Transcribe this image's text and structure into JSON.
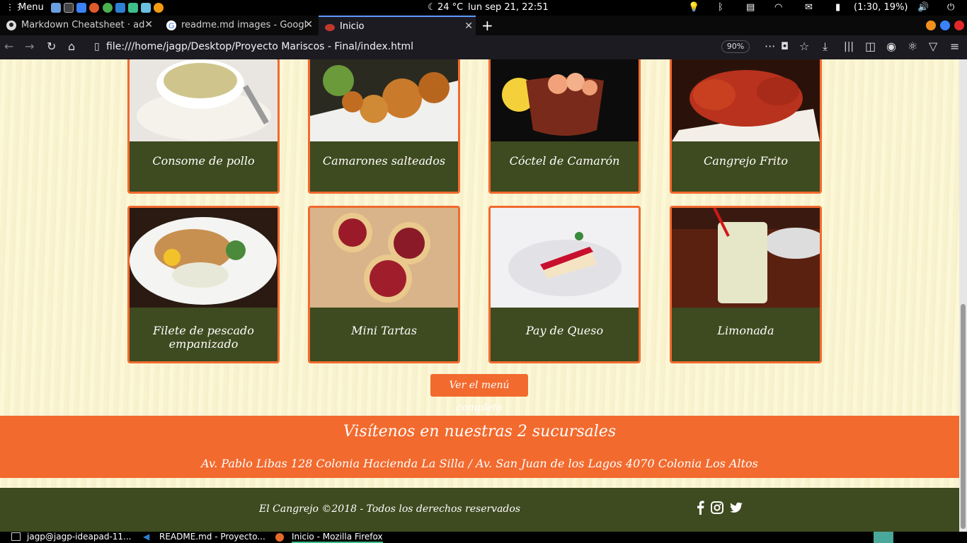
{
  "system_bar": {
    "menu_label": "Menu",
    "weather": "24 °C",
    "clock": "lun sep 21, 22:51",
    "battery": "(1:30, 19%)"
  },
  "browser": {
    "tabs": [
      {
        "title": "Markdown Cheatsheet · ad",
        "icon": "github-icon"
      },
      {
        "title": "readme.md images - Googl",
        "icon": "google-icon"
      },
      {
        "title": "Inicio",
        "icon": "crab-icon",
        "active": true
      }
    ],
    "url": "file:///home/jagp/Desktop/Proyecto Mariscos - Final/index.html",
    "zoom": "90%"
  },
  "menu_items": [
    {
      "name": "Consome de pollo"
    },
    {
      "name": "Camarones salteados"
    },
    {
      "name": "Cóctel de Camarón"
    },
    {
      "name": "Cangrejo Frito"
    },
    {
      "name": "Filete de pescado empanizado"
    },
    {
      "name": "Mini Tartas"
    },
    {
      "name": "Pay de Queso"
    },
    {
      "name": "Limonada"
    }
  ],
  "menu_button": "Ver el menú completo",
  "branches": {
    "heading": "Visítenos en nuestras 2 sucursales",
    "addresses": "Av. Pablo Libas 128 Colonia Hacienda La Silla / Av. San Juan de los Lagos 4070 Colonia Los Altos"
  },
  "footer": {
    "copyright": "El Cangrejo ©2018 - Todos los derechos reservados",
    "social": [
      "facebook-icon",
      "instagram-icon",
      "twitter-icon"
    ]
  },
  "taskbar": {
    "items": [
      "jagp@jagp-ideapad-11...",
      "README.md - Proyecto...",
      "Inicio - Mozilla Firefox"
    ]
  },
  "colors": {
    "accent": "#f26a2e",
    "olive": "#3e4a1f",
    "cream": "#fbf5d2"
  }
}
